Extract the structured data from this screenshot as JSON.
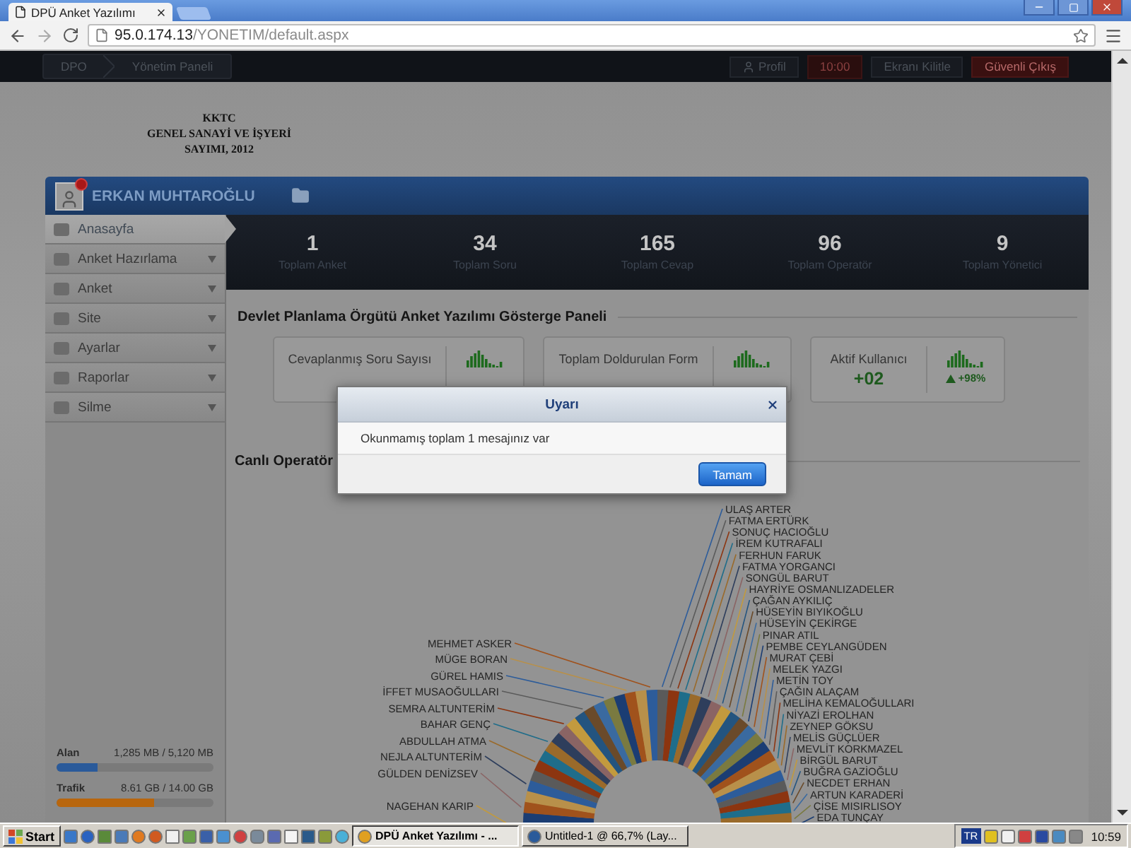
{
  "browser": {
    "tab_title": "DPÜ Anket Yazılımı",
    "url_host": "95.0.174.13",
    "url_path": "/YONETIM/default.aspx"
  },
  "navbar": {
    "breadcrumb": [
      "DPO",
      "Yönetim Paneli"
    ],
    "profile": "Profil",
    "timer": "10:00",
    "lock": "Ekranı Kilitle",
    "logout": "Güvenli Çıkış"
  },
  "header_lines": [
    "KKTC",
    "GENEL SANAYİ VE İŞYERİ",
    "SAYIMI, 2012"
  ],
  "user": {
    "name": "ERKAN MUHTAROĞLU",
    "has_notification": true
  },
  "menu": [
    {
      "label": "Anasayfa",
      "selected": true,
      "has_submenu": false
    },
    {
      "label": "Anket Hazırlama",
      "selected": false,
      "has_submenu": true
    },
    {
      "label": "Anket",
      "selected": false,
      "has_submenu": true
    },
    {
      "label": "Site",
      "selected": false,
      "has_submenu": true
    },
    {
      "label": "Ayarlar",
      "selected": false,
      "has_submenu": true
    },
    {
      "label": "Raporlar",
      "selected": false,
      "has_submenu": true
    },
    {
      "label": "Silme",
      "selected": false,
      "has_submenu": true
    }
  ],
  "usage": [
    {
      "label": "Alan",
      "reading": "1,285 MB / 5,120 MB",
      "level": 0.26,
      "color": "#2a5a9a"
    },
    {
      "label": "Trafik",
      "reading": "8.61 GB / 14.00 GB",
      "level": 0.62,
      "color": "#b8660e"
    }
  ],
  "stats": [
    {
      "value": "1",
      "label": "Toplam Anket"
    },
    {
      "value": "34",
      "label": "Toplam Soru"
    },
    {
      "value": "165",
      "label": "Toplam Cevap"
    },
    {
      "value": "96",
      "label": "Toplam Operatör"
    },
    {
      "value": "9",
      "label": "Toplam Yönetici"
    }
  ],
  "dashboard_title": "Devlet Planlama Örgütü Anket Yazılımı Gösterge Paneli",
  "summary_cards": [
    {
      "label": "Cevaplanmış Soru Sayısı"
    },
    {
      "label": "Toplam Doldurulan Form"
    },
    {
      "label": "Aktif Kullanıcı",
      "value": "+02",
      "change": "+98%"
    }
  ],
  "live_title": "Canlı Operatör",
  "operators_left": [
    "MEHMET ASKER",
    "MÜGE BORAN",
    "GÜREL HAMIS",
    "İFFET MUSAOĞULLARI",
    "SEMRA ALTUNTERİM",
    "BAHAR GENÇ",
    "ABDULLAH ATMA",
    "NEJLA ALTUNTERİM",
    "GÜLDEN DENİZSEV",
    "NAGEHAN KARIP"
  ],
  "operators_right": [
    "ULAŞ ARTER",
    "FATMA ERTÜRK",
    "SONUÇ HACIOĞLU",
    "İREM KUTRAFALI",
    "FERHUN FARUK",
    "FATMA YORGANCI",
    "SONGÜL BARUT",
    "HAYRİYE OSMANLIZADELER",
    "ÇAĞAN AYKILIÇ",
    "HÜSEYİN BIYIKOĞLU",
    "HÜSEYİN ÇEKİRGE",
    "PINAR ATIL",
    "PEMBE CEYLANGÜDEN",
    "MURAT ÇEBİ",
    "MELEK YAZGI",
    "METİN TOY",
    "ÇAĞIN ALAÇAM",
    "MELİHA KEMALOĞULLARI",
    "NİYAZİ EROLHAN",
    "ZEYNEP GÖKSU",
    "MELİS GÜÇLÜER",
    "MEVLİT KORKMAZEL",
    "BİRGÜL BARUT",
    "BUĞRA GAZİOĞLU",
    "NECDET ERHAN",
    "ARTUN KARADERİ",
    "ÇİSE MISIRLISOY",
    "EDA TUNÇAY"
  ],
  "dialog": {
    "title": "Uyarı",
    "message": "Okunmamış toplam 1 mesajınız var",
    "button": "Tamam"
  },
  "taskbar": {
    "start": "Start",
    "tasks": [
      {
        "label": "DPÜ Anket Yazılımı - ...",
        "selected": true
      },
      {
        "label": "Untitled-1 @ 66,7% (Lay...",
        "selected": false
      }
    ],
    "language": "TR",
    "clock": "10:59"
  }
}
